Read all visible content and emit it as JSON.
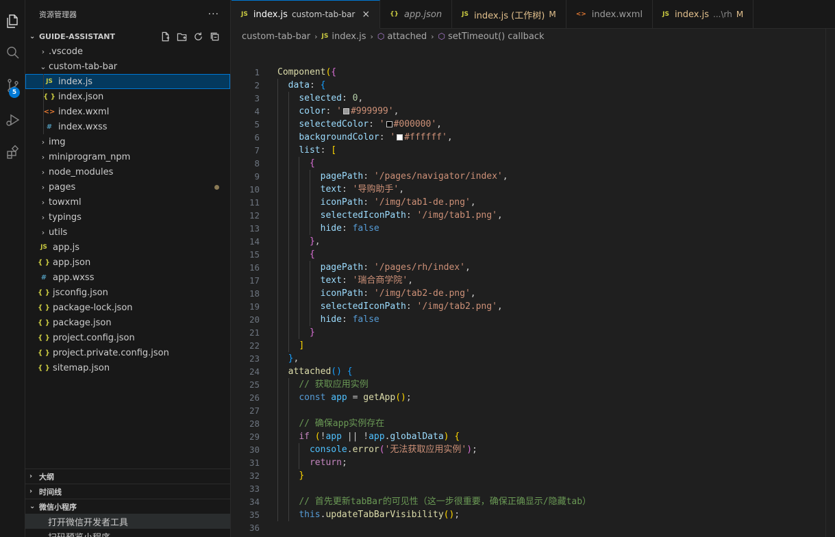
{
  "activity": {
    "scm_badge": "5"
  },
  "explorer": {
    "title": "资源管理器",
    "more": "···",
    "project": "GUIDE-ASSISTANT",
    "tree": [
      {
        "label": ".vscode",
        "type": "folder",
        "open": false,
        "depth": 0
      },
      {
        "label": "custom-tab-bar",
        "type": "folder",
        "open": true,
        "depth": 0
      },
      {
        "label": "index.js",
        "type": "js",
        "depth": 1,
        "selected": true
      },
      {
        "label": "index.json",
        "type": "json",
        "depth": 1
      },
      {
        "label": "index.wxml",
        "type": "wxml",
        "depth": 1
      },
      {
        "label": "index.wxss",
        "type": "wxss",
        "depth": 1
      },
      {
        "label": "img",
        "type": "folder",
        "open": false,
        "depth": 0
      },
      {
        "label": "miniprogram_npm",
        "type": "folder",
        "open": false,
        "depth": 0
      },
      {
        "label": "node_modules",
        "type": "folder",
        "open": false,
        "depth": 0
      },
      {
        "label": "pages",
        "type": "folder",
        "open": false,
        "depth": 0,
        "modified": true
      },
      {
        "label": "towxml",
        "type": "folder",
        "open": false,
        "depth": 0
      },
      {
        "label": "typings",
        "type": "folder",
        "open": false,
        "depth": 0
      },
      {
        "label": "utils",
        "type": "folder",
        "open": false,
        "depth": 0
      },
      {
        "label": "app.js",
        "type": "js",
        "depth": 0
      },
      {
        "label": "app.json",
        "type": "json",
        "depth": 0
      },
      {
        "label": "app.wxss",
        "type": "wxss",
        "depth": 0
      },
      {
        "label": "jsconfig.json",
        "type": "json",
        "depth": 0
      },
      {
        "label": "package-lock.json",
        "type": "json",
        "depth": 0
      },
      {
        "label": "package.json",
        "type": "json",
        "depth": 0
      },
      {
        "label": "project.config.json",
        "type": "json",
        "depth": 0
      },
      {
        "label": "project.private.config.json",
        "type": "json",
        "depth": 0
      },
      {
        "label": "sitemap.json",
        "type": "json",
        "depth": 0
      }
    ],
    "sections": {
      "outline": "大纲",
      "timeline": "时间线",
      "wechat": "微信小程序"
    },
    "wechat_items": [
      "打开微信开发者工具",
      "扫码预览小程序"
    ]
  },
  "tabs": [
    {
      "icon": "JS",
      "name": "index.js",
      "desc": "custom-tab-bar",
      "active": true,
      "close": "×"
    },
    {
      "icon": "{}",
      "name": "app.json",
      "italic": true
    },
    {
      "icon": "JS",
      "name": "index.js (工作树)",
      "mod": "M"
    },
    {
      "icon": "<>",
      "name": "index.wxml"
    },
    {
      "icon": "JS",
      "name": "index.js",
      "desc": "...\\rh",
      "mod": "M"
    }
  ],
  "breadcrumb": [
    "custom-tab-bar",
    "index.js",
    "attached",
    "setTimeout() callback"
  ],
  "colors": {
    "accent": "#0078d4",
    "editor_bg": "#1f1f1f",
    "sidebar_bg": "#181818"
  },
  "code": {
    "start_line": 1,
    "lines": [
      "Component({",
      "  data: {",
      "    selected: 0,",
      "    color: '#999999',",
      "    selectedColor: '#000000',",
      "    backgroundColor: '#ffffff',",
      "    list: [",
      "      {",
      "        pagePath: '/pages/navigator/index',",
      "        text: '导购助手',",
      "        iconPath: '/img/tab1-de.png',",
      "        selectedIconPath: '/img/tab1.png',",
      "        hide: false",
      "      },",
      "      {",
      "        pagePath: '/pages/rh/index',",
      "        text: '瑞合商学院',",
      "        iconPath: '/img/tab2-de.png',",
      "        selectedIconPath: '/img/tab2.png',",
      "        hide: false",
      "      }",
      "    ]",
      "  },",
      "  attached() {",
      "    // 获取应用实例",
      "    const app = getApp();",
      "",
      "    // 确保app实例存在",
      "    if (!app || !app.globalData) {",
      "      console.error('无法获取应用实例');",
      "      return;",
      "    }",
      "",
      "    // 首先更新tabBar的可见性（这一步很重要，确保正确显示/隐藏tab）",
      "    this.updateTabBarVisibility();",
      ""
    ]
  }
}
